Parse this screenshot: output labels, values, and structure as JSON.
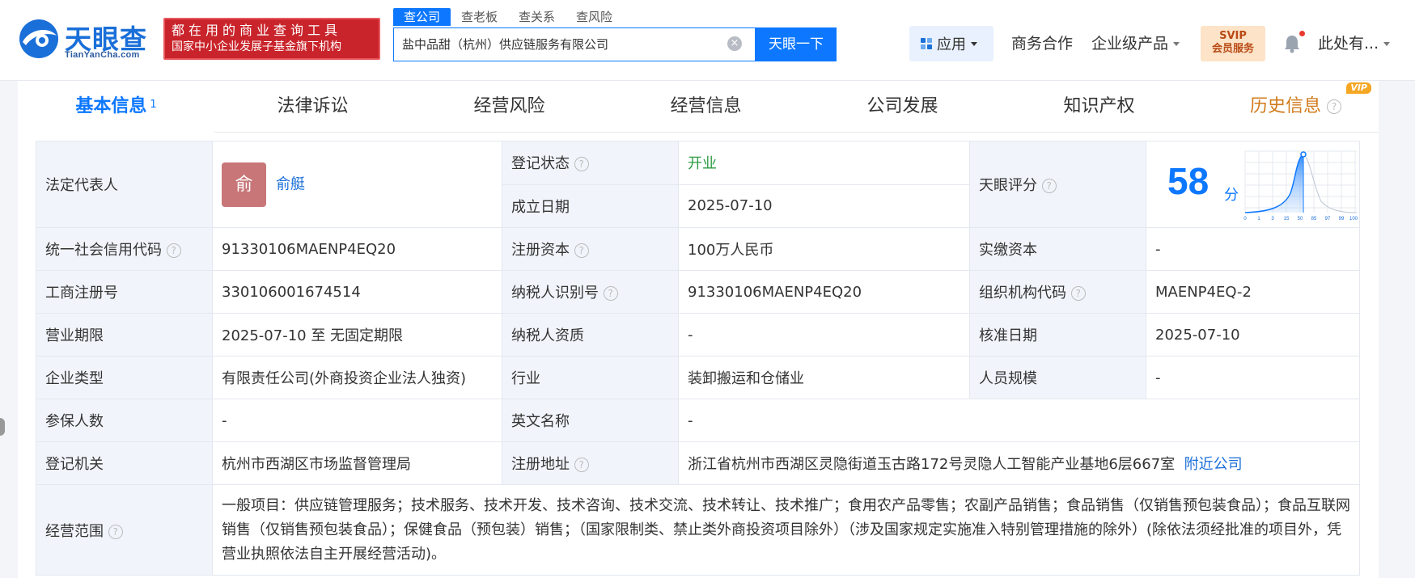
{
  "header": {
    "logo_text": "天眼查",
    "logo_sub": "TianYanCha.com",
    "slogan_line1": "都在用的商业查询工具",
    "slogan_line2": "国家中小企业发展子基金旗下机构",
    "search_tabs": [
      "查公司",
      "查老板",
      "查关系",
      "查风险"
    ],
    "search_value": "盐中品甜（杭州）供应链服务有限公司",
    "search_button": "天眼一下",
    "app_label": "应用",
    "biz_coop": "商务合作",
    "enterprise_products": "企业级产品",
    "svip_line1": "SVIP",
    "svip_line2": "会员服务",
    "user_name": "此处有..."
  },
  "tabs": [
    {
      "label": "基本信息",
      "count": "1"
    },
    {
      "label": "法律诉讼"
    },
    {
      "label": "经营风险"
    },
    {
      "label": "经营信息"
    },
    {
      "label": "公司发展"
    },
    {
      "label": "知识产权"
    },
    {
      "label": "历史信息",
      "badge": "VIP"
    }
  ],
  "info": {
    "legal_rep_label": "法定代表人",
    "legal_rep_avatar": "俞",
    "legal_rep_name": "俞艇",
    "reg_status_label": "登记状态",
    "reg_status_value": "开业",
    "est_date_label": "成立日期",
    "est_date_value": "2025-07-10",
    "score_label": "天眼评分",
    "score_value": "58",
    "score_unit": "分",
    "score_ticks": [
      "0",
      "1",
      "3",
      "15",
      "50",
      "85",
      "97",
      "99",
      "100"
    ],
    "credit_code_label": "统一社会信用代码",
    "credit_code_value": "91330106MAENP4EQ20",
    "reg_capital_label": "注册资本",
    "reg_capital_value": "100万人民币",
    "paid_capital_label": "实缴资本",
    "paid_capital_value": "-",
    "biz_reg_no_label": "工商注册号",
    "biz_reg_no_value": "330106001674514",
    "taxpayer_id_label": "纳税人识别号",
    "taxpayer_id_value": "91330106MAENP4EQ20",
    "org_code_label": "组织机构代码",
    "org_code_value": "MAENP4EQ-2",
    "term_label": "营业期限",
    "term_value": "2025-07-10 至 无固定期限",
    "taxpayer_qual_label": "纳税人资质",
    "taxpayer_qual_value": "-",
    "approval_date_label": "核准日期",
    "approval_date_value": "2025-07-10",
    "company_type_label": "企业类型",
    "company_type_value": "有限责任公司(外商投资企业法人独资)",
    "industry_label": "行业",
    "industry_value": "装卸搬运和仓储业",
    "staff_size_label": "人员规模",
    "staff_size_value": "-",
    "insured_label": "参保人数",
    "insured_value": "-",
    "english_name_label": "英文名称",
    "english_name_value": "-",
    "reg_authority_label": "登记机关",
    "reg_authority_value": "杭州市西湖区市场监督管理局",
    "reg_address_label": "注册地址",
    "reg_address_value": "浙江省杭州市西湖区灵隐街道玉古路172号灵隐人工智能产业基地6层667室",
    "nearby_link": "附近公司",
    "scope_label": "经营范围",
    "scope_value": "一般项目：供应链管理服务；技术服务、技术开发、技术咨询、技术交流、技术转让、技术推广；食用农产品零售；农副产品销售；食品销售（仅销售预包装食品）；食品互联网销售（仅销售预包装食品）；保健食品（预包装）销售；（国家限制类、禁止类外商投资项目除外）（涉及国家规定实施准入特别管理措施的除外）(除依法须经批准的项目外，凭营业执照依法自主开展经营活动)。"
  },
  "colors": {
    "brand_blue": "#0d78ff",
    "slogan_red": "#c9242b",
    "status_green": "#2b9b43",
    "history_orange": "#d17a1b"
  }
}
